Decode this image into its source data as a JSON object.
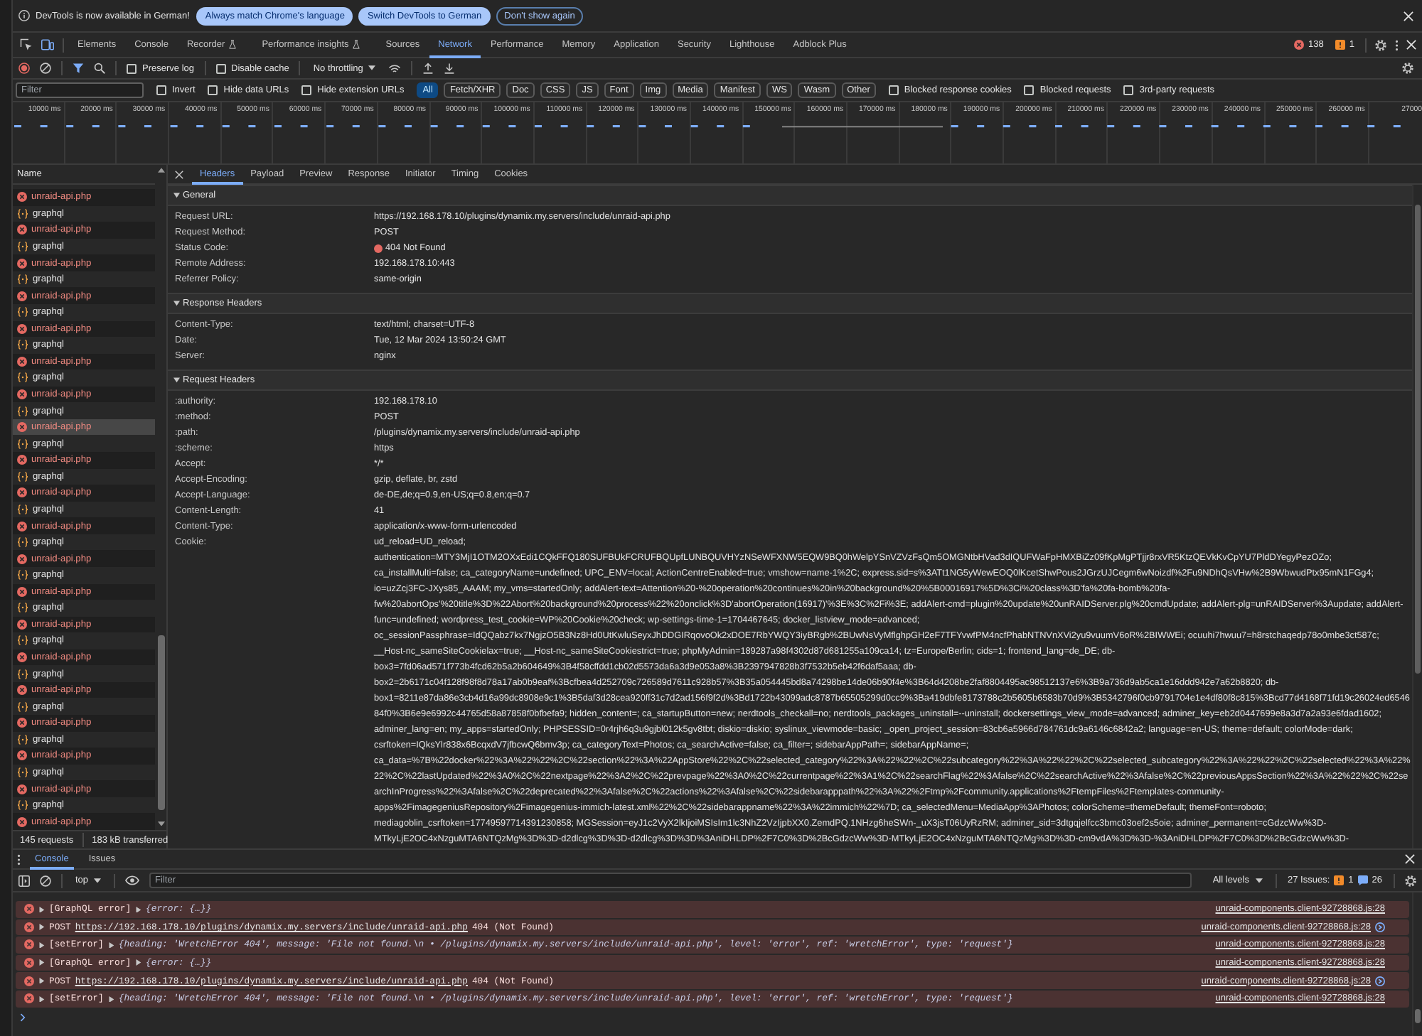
{
  "infobar": {
    "message": "DevTools is now available in German!",
    "buttons": [
      {
        "label": "Always match Chrome's language",
        "kind": "primary"
      },
      {
        "label": "Switch DevTools to German",
        "kind": "primary"
      },
      {
        "label": "Don't show again",
        "kind": "outline"
      }
    ]
  },
  "tabbar": {
    "device_mode": true,
    "tabs": [
      {
        "label": "Elements",
        "selected": false,
        "experimental": false
      },
      {
        "label": "Console",
        "selected": false,
        "experimental": false
      },
      {
        "label": "Recorder",
        "selected": false,
        "experimental": true
      },
      {
        "label": "Performance insights",
        "selected": false,
        "experimental": true
      },
      {
        "label": "Sources",
        "selected": false,
        "experimental": false
      },
      {
        "label": "Network",
        "selected": true,
        "experimental": false
      },
      {
        "label": "Performance",
        "selected": false,
        "experimental": false
      },
      {
        "label": "Memory",
        "selected": false,
        "experimental": false
      },
      {
        "label": "Application",
        "selected": false,
        "experimental": false
      },
      {
        "label": "Security",
        "selected": false,
        "experimental": false
      },
      {
        "label": "Lighthouse",
        "selected": false,
        "experimental": false
      },
      {
        "label": "Adblock Plus",
        "selected": false,
        "experimental": false
      }
    ],
    "errors": "138",
    "warnings": "1"
  },
  "network_toolbar": {
    "recording": true,
    "filter_shown": true,
    "options": [
      {
        "label": "Preserve log",
        "checked": false
      },
      {
        "label": "Disable cache",
        "checked": false
      }
    ],
    "throttling": "No throttling"
  },
  "filter_bar": {
    "placeholder": "Filter",
    "options": [
      {
        "label": "Invert",
        "checked": false
      },
      {
        "label": "Hide data URLs",
        "checked": false
      },
      {
        "label": "Hide extension URLs",
        "checked": false
      }
    ],
    "types": [
      {
        "label": "All",
        "selected": true
      },
      {
        "label": "Fetch/XHR",
        "selected": false
      },
      {
        "label": "Doc",
        "selected": false
      },
      {
        "label": "CSS",
        "selected": false
      },
      {
        "label": "JS",
        "selected": false
      },
      {
        "label": "Font",
        "selected": false
      },
      {
        "label": "Img",
        "selected": false
      },
      {
        "label": "Media",
        "selected": false
      },
      {
        "label": "Manifest",
        "selected": false
      },
      {
        "label": "WS",
        "selected": false
      },
      {
        "label": "Wasm",
        "selected": false
      },
      {
        "label": "Other",
        "selected": false
      }
    ],
    "blocking": [
      {
        "label": "Blocked response cookies",
        "checked": false
      },
      {
        "label": "Blocked requests",
        "checked": false
      },
      {
        "label": "3rd-party requests",
        "checked": false
      }
    ]
  },
  "timeline": {
    "ticks": [
      "10000 ms",
      "20000 ms",
      "30000 ms",
      "40000 ms",
      "50000 ms",
      "60000 ms",
      "70000 ms",
      "80000 ms",
      "90000 ms",
      "100000 ms",
      "110000 ms",
      "120000 ms",
      "130000 ms",
      "140000 ms",
      "150000 ms",
      "160000 ms",
      "170000 ms",
      "180000 ms",
      "190000 ms",
      "200000 ms",
      "210000 ms",
      "220000 ms",
      "230000 ms",
      "240000 ms",
      "250000 ms",
      "260000 ms",
      "27000"
    ]
  },
  "request_list": {
    "column": "Name",
    "rows": [
      {
        "name": "unraid-api.php",
        "kind": "failed",
        "selected": false
      },
      {
        "name": "graphql",
        "kind": "fetch",
        "selected": false
      },
      {
        "name": "unraid-api.php",
        "kind": "failed",
        "selected": false
      },
      {
        "name": "graphql",
        "kind": "fetch",
        "selected": false
      },
      {
        "name": "unraid-api.php",
        "kind": "failed",
        "selected": false
      },
      {
        "name": "graphql",
        "kind": "fetch",
        "selected": false
      },
      {
        "name": "unraid-api.php",
        "kind": "failed",
        "selected": false
      },
      {
        "name": "graphql",
        "kind": "fetch",
        "selected": false
      },
      {
        "name": "unraid-api.php",
        "kind": "failed",
        "selected": false
      },
      {
        "name": "graphql",
        "kind": "fetch",
        "selected": false
      },
      {
        "name": "unraid-api.php",
        "kind": "failed",
        "selected": false
      },
      {
        "name": "graphql",
        "kind": "fetch",
        "selected": false
      },
      {
        "name": "unraid-api.php",
        "kind": "failed",
        "selected": false
      },
      {
        "name": "graphql",
        "kind": "fetch",
        "selected": false
      },
      {
        "name": "unraid-api.php",
        "kind": "failed",
        "selected": true
      },
      {
        "name": "graphql",
        "kind": "fetch",
        "selected": false
      },
      {
        "name": "unraid-api.php",
        "kind": "failed",
        "selected": false
      },
      {
        "name": "graphql",
        "kind": "fetch",
        "selected": false
      },
      {
        "name": "unraid-api.php",
        "kind": "failed",
        "selected": false
      },
      {
        "name": "graphql",
        "kind": "fetch",
        "selected": false
      },
      {
        "name": "unraid-api.php",
        "kind": "failed",
        "selected": false
      },
      {
        "name": "graphql",
        "kind": "fetch",
        "selected": false
      },
      {
        "name": "unraid-api.php",
        "kind": "failed",
        "selected": false
      },
      {
        "name": "graphql",
        "kind": "fetch",
        "selected": false
      },
      {
        "name": "unraid-api.php",
        "kind": "failed",
        "selected": false
      },
      {
        "name": "graphql",
        "kind": "fetch",
        "selected": false
      },
      {
        "name": "unraid-api.php",
        "kind": "failed",
        "selected": false
      },
      {
        "name": "graphql",
        "kind": "fetch",
        "selected": false
      },
      {
        "name": "unraid-api.php",
        "kind": "failed",
        "selected": false
      },
      {
        "name": "graphql",
        "kind": "fetch",
        "selected": false
      },
      {
        "name": "unraid-api.php",
        "kind": "failed",
        "selected": false
      },
      {
        "name": "graphql",
        "kind": "fetch",
        "selected": false
      },
      {
        "name": "unraid-api.php",
        "kind": "failed",
        "selected": false
      },
      {
        "name": "graphql",
        "kind": "fetch",
        "selected": false
      },
      {
        "name": "unraid-api.php",
        "kind": "failed",
        "selected": false
      },
      {
        "name": "graphql",
        "kind": "fetch",
        "selected": false
      },
      {
        "name": "unraid-api.php",
        "kind": "failed",
        "selected": false
      },
      {
        "name": "graphql",
        "kind": "fetch",
        "selected": false
      },
      {
        "name": "unraid-api.php",
        "kind": "failed",
        "selected": false
      }
    ],
    "requests": "145 requests",
    "transferred": "183 kB transferred"
  },
  "details": {
    "tabs": [
      {
        "label": "Headers",
        "selected": true
      },
      {
        "label": "Payload",
        "selected": false
      },
      {
        "label": "Preview",
        "selected": false
      },
      {
        "label": "Response",
        "selected": false
      },
      {
        "label": "Initiator",
        "selected": false
      },
      {
        "label": "Timing",
        "selected": false
      },
      {
        "label": "Cookies",
        "selected": false
      }
    ],
    "sections": [
      {
        "title": "General",
        "expanded": true,
        "rows": [
          {
            "name": "Request URL:",
            "value": "https://192.168.178.10/plugins/dynamix.my.servers/include/unraid-api.php"
          },
          {
            "name": "Request Method:",
            "value": "POST"
          },
          {
            "name": "Status Code:",
            "value": "404 Not Found",
            "color": "#e46962"
          },
          {
            "name": "Remote Address:",
            "value": "192.168.178.10:443"
          },
          {
            "name": "Referrer Policy:",
            "value": "same-origin"
          }
        ]
      },
      {
        "title": "Response Headers",
        "expanded": true,
        "rows": [
          {
            "name": "Content-Type:",
            "value": "text/html; charset=UTF-8"
          },
          {
            "name": "Date:",
            "value": "Tue, 12 Mar 2024 13:50:24 GMT"
          },
          {
            "name": "Server:",
            "value": "nginx"
          }
        ]
      },
      {
        "title": "Request Headers",
        "expanded": true,
        "rows": [
          {
            "name": ":authority:",
            "value": "192.168.178.10"
          },
          {
            "name": ":method:",
            "value": "POST"
          },
          {
            "name": ":path:",
            "value": "/plugins/dynamix.my.servers/include/unraid-api.php"
          },
          {
            "name": ":scheme:",
            "value": "https"
          },
          {
            "name": "Accept:",
            "value": "*/*"
          },
          {
            "name": "Accept-Encoding:",
            "value": "gzip, deflate, br, zstd"
          },
          {
            "name": "Accept-Language:",
            "value": "de-DE,de;q=0.9,en-US;q=0.8,en;q=0.7"
          },
          {
            "name": "Content-Length:",
            "value": "41"
          },
          {
            "name": "Content-Type:",
            "value": "application/x-www-form-urlencoded"
          },
          {
            "name": "Cookie:",
            "value": "ud_reload=UD_reload; authentication=MTY3MjI1OTM2OXxEdi1CQkFFQ180SUFBUkFCRUFBQUpfLUNBQUVHYzNSeWFXNW5EQW9BQ0hWelpYSnVZVzFsQm5OMGNtbHVad3dIQUFWaFpHMXBiZz09fKpMgPTjjr8rxVR5KtzQEVkKvCpYU7PldDYegyPezOZo; ca_installMulti=false; ca_categoryName=undefined; UPC_ENV=local; ActionCentreEnabled=true; vmshow=name-1%2C; express.sid=s%3ATt1NG5yWewEOQ0lKcetShwPous2JGrzUJCegm6wNoizdf%2Fu9NDhQsVHw%2B9WbwudPtx95mN1FGg4; io=uzZcj3FC-JXys85_AAAM; my_vms=startedOnly; addAlert-text=Attention%20-%20operation%20continues%20in%20background%20%5B00016917%5D%3Ci%20class%3D'fa%20fa-bomb%20fa-fw%20abortOps'%20title%3D%22Abort%20background%20process%22%20onclick%3D'abortOperation(16917)'%3E%3C%2Fi%3E; addAlert-cmd=plugin%20update%20unRAIDServer.plg%20cmdUpdate; addAlert-plg=unRAIDServer%3Aupdate; addAlert-func=undefined; wordpress_test_cookie=WP%20Cookie%20check; wp-settings-time-1=1704467645; docker_listview_mode=advanced; oc_sessionPassphrase=IdQQabz7kx7NgjzO5B3Nz8Hd0UtKwluSeyxJhDDGIRqovoOk2xDOE7RbYWQY3iyBRgb%2BUwNsVyMflghpGH2eF7TFYvwfPM4ncfPhabNTNVnXVi2yu9vuumV6oR%2BIWWEi; ocuuhi7hwuu7=h8rstchaqedp78o0mbe3ct587c; __Host-nc_sameSiteCookielax=true; __Host-nc_sameSiteCookiestrict=true; phpMyAdmin=189287a98f4302d87d681255a109ca14; tz=Europe/Berlin; cids=1; frontend_lang=de_DE; db-box3=7fd06ad571f773b4fcd62b5a2b604649%3B4f58cffdd1cb02d5573da6a3d9e053a8%3B2397947828b3f7532b5eb42f6daf5aaa; db-box2=2b6171c04f128f98f8d78a17ab0b9eaf%3Bcfbea4d252709c726589d7611c928b57%3B35a054445bd8a74298be14de06b90f4e%3B64d4208be2faf8804495ac98512137e6%3B9a736d9ab5ca1e16ddd942e7a62b8820; db-box1=8211e87da86e3cb4d16a99dc8908e9c1%3B5daf3d28cea920ff31c7d2ad156f9f2d%3Bd1722b43099adc8787b65505299d0cc9%3Ba419dbfe8173788c2b5605b6583b70d9%3B5342796f0cb9791704e1e4df80f8c815%3Bcd77d4168f71fd19c26024ed654684f0%3B6e9e6992c44765d58a87858f0bfbefa9; hidden_content=; ca_startupButton=new; nerdtools_checkall=no; nerdtools_packages_uninstall=--uninstall; dockersettings_view_mode=advanced; adminer_key=eb2d0447699e8a3d7a2a93e6fdad1602; adminer_lang=en; my_apps=startedOnly; PHPSESSID=0r4rjh6q3u9gjbl012k5gv8tbt; diskio=diskio; syslinux_viewmode=basic; _open_project_session=83cb6a5966d784761dc9a6146c6842a2; language=en-US; theme=default; colorMode=dark; csrftoken=IQksYlr838x6BcqxdV7jfbcwQ6bmv3p; ca_categoryText=Photos; ca_searchActive=false; ca_filter=; sidebarAppPath=; sidebarAppName=; ca_data=%7B%22docker%22%3A%22%22%2C%22section%22%3A%22AppStore%22%2C%22selected_category%22%3A%22%22%2C%22subcategory%22%3A%22%22%2C%22selected_subcategory%22%3A%22%22%2C%22selected%22%3A%22%22%2C%22lastUpdated%22%3A0%2C%22nextpage%22%3A2%2C%22prevpage%22%3A0%2C%22currentpage%22%3A1%2C%22searchFlag%22%3Afalse%2C%22searchActive%22%3Afalse%2C%22previousAppsSection%22%3A%22%22%2C%22searchInProgress%22%3Afalse%2C%22deprecated%22%3Afalse%2C%22actions%22%3Afalse%2C%22sidebarapppath%22%3A%22%2Ftmp%2Fcommunity.applications%2FtempFiles%2Ftemplates-community-apps%2FimagegeniusRepository%2Fimagegenius-immich-latest.xml%22%2C%22sidebarappname%22%3A%22immich%22%7D; ca_selectedMenu=MediaApp%3APhotos; colorScheme=themeDefault; themeFont=roboto; mediagoblin_csrftoken=17749597714391230858; MGSession=eyJ1c2VyX2lkIjoiMSIsIm1lc3NhZ2VzIjpbXX0.ZemdPQ.1NHzg6heSWn-_uX3jsT06UyRzRM; adminer_sid=3dtgqjelfcc3bmc03oef2s5oie; adminer_permanent=cGdzcWw%3D-MTkyLjE2OC4xNzguMTA6NTQzMg%3D%3D-d2dlcg%3D%3D-d2dlcg%3D%3D%3AniDHLDP%2F7C0%3D%2BcGdzcWw%3D-MTkyLjE2OC4xNzguMTA6NTQzMg%3D%3D-cm9vdA%3D%3D-%3AniDHLDP%2F7C0%3D%2BcGdzcWw%3D-"
          }
        ]
      }
    ]
  },
  "console": {
    "tabs": [
      {
        "label": "Console",
        "selected": true
      },
      {
        "label": "Issues",
        "selected": false
      }
    ],
    "context": "top",
    "placeholder": "Filter",
    "levels": "All levels",
    "issues": "27 Issues:",
    "issue_warnings": "1",
    "issue_infos": "26",
    "messages": [
      {
        "kind": "log",
        "error": true,
        "expanded": false,
        "label": "[GraphQL error]",
        "object_expanded": false,
        "object": "{error: {…}}",
        "source": "unraid-components.client-92728868.js:28"
      },
      {
        "kind": "network",
        "error": true,
        "expanded": false,
        "method": "POST",
        "url": "https://192.168.178.10/plugins/dynamix.my.servers/include/unraid-api.php",
        "status": "404 (Not Found)",
        "source": "unraid-components.client-92728868.js:28"
      },
      {
        "kind": "log",
        "error": true,
        "expanded": false,
        "label": "[setError]",
        "object_expanded": false,
        "object": "{heading: 'WretchError 404', message: 'File not found.\\n • /plugins/dynamix.my.servers/include/unraid-api.php', level: 'error', ref: 'wretchError', type: 'request'}",
        "source": "unraid-components.client-92728868.js:28"
      },
      {
        "kind": "log",
        "error": true,
        "expanded": false,
        "label": "[GraphQL error]",
        "object_expanded": false,
        "object": "{error: {…}}",
        "source": "unraid-components.client-92728868.js:28"
      },
      {
        "kind": "network",
        "error": true,
        "expanded": false,
        "method": "POST",
        "url": "https://192.168.178.10/plugins/dynamix.my.servers/include/unraid-api.php",
        "status": "404 (Not Found)",
        "source": "unraid-components.client-92728868.js:28"
      },
      {
        "kind": "log",
        "error": true,
        "expanded": false,
        "label": "[setError]",
        "object_expanded": false,
        "object": "{heading: 'WretchError 404', message: 'File not found.\\n • /plugins/dynamix.my.servers/include/unraid-api.php', level: 'error', ref: 'wretchError', type: 'request'}",
        "source": "unraid-components.client-92728868.js:28"
      }
    ]
  }
}
